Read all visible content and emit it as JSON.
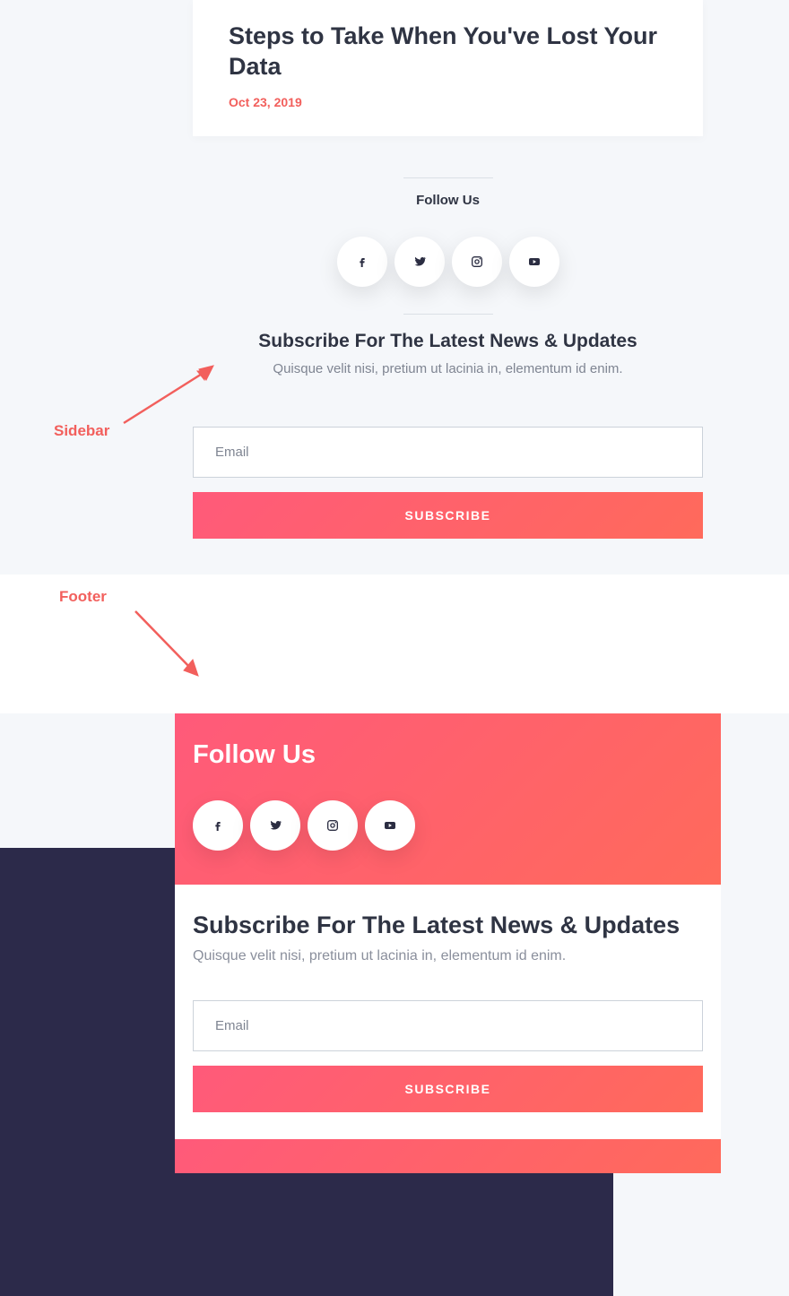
{
  "article": {
    "title": "Steps to Take When You've Lost Your Data",
    "date": "Oct 23, 2019"
  },
  "sidebar": {
    "follow_label": "Follow Us",
    "subscribe_heading": "Subscribe For The Latest News & Updates",
    "subscribe_text": "Quisque velit nisi, pretium ut lacinia in, elementum id enim.",
    "email_placeholder": "Email",
    "subscribe_button": "SUBSCRIBE"
  },
  "footer": {
    "follow_label": "Follow Us",
    "subscribe_heading": "Subscribe For The Latest News & Updates",
    "subscribe_text": "Quisque velit nisi, pretium ut lacinia in, elementum id enim.",
    "email_placeholder": "Email",
    "subscribe_button": "SUBSCRIBE"
  },
  "annotations": {
    "sidebar_label": "Sidebar",
    "footer_label": "Footer"
  }
}
